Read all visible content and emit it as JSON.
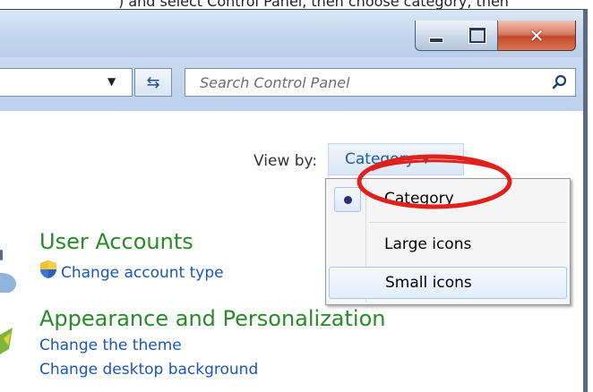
{
  "caption": {
    "text": ") and select Control Panel, then choose category, then"
  },
  "window_controls": {
    "minimize": "minimize",
    "maximize": "maximize",
    "close": "close"
  },
  "address_bar": {
    "search_placeholder": "Search Control Panel"
  },
  "view_by": {
    "label": "View by:",
    "selected": "Category"
  },
  "view_menu": {
    "items": [
      {
        "label": "Category",
        "selected": true
      },
      {
        "label": "Large icons",
        "selected": false
      },
      {
        "label": "Small icons",
        "selected": false,
        "hovered": true
      }
    ]
  },
  "categories": [
    {
      "title": "User Accounts",
      "links": [
        "Change account type"
      ]
    },
    {
      "title": "Appearance and Personalization",
      "links": [
        "Change the theme",
        "Change desktop background"
      ]
    }
  ],
  "colors": {
    "heading_green": "#2a8a2a",
    "link_blue": "#1a56b5",
    "annotation_red": "#e0201b"
  }
}
